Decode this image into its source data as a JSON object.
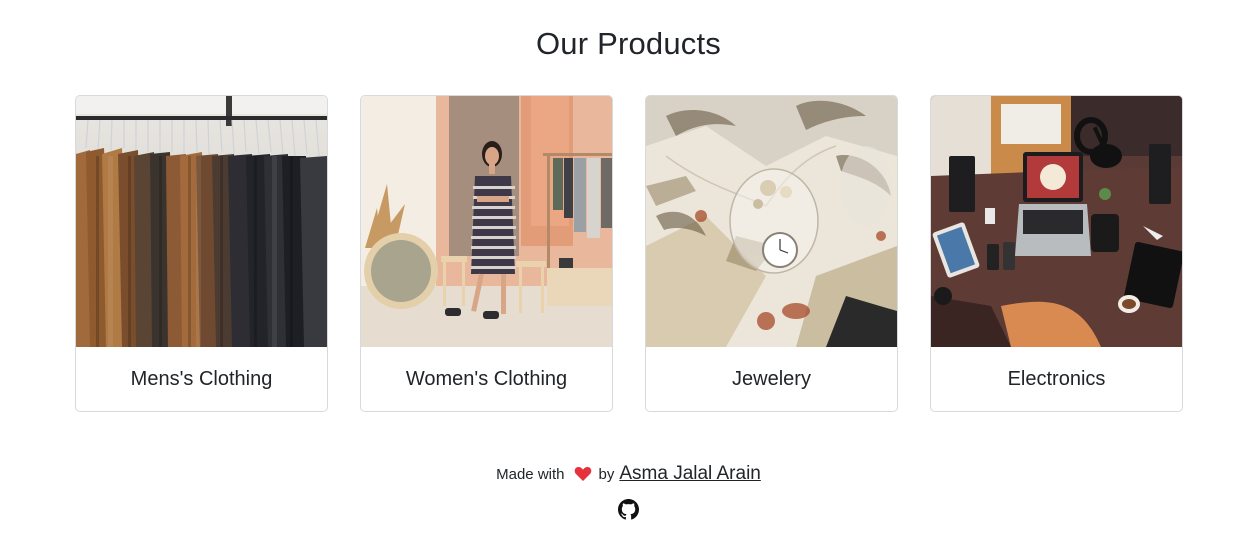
{
  "page": {
    "title": "Our Products"
  },
  "categories": [
    {
      "label": "Mens's Clothing",
      "image": "mens-clothing-image"
    },
    {
      "label": "Women's Clothing",
      "image": "womens-clothing-image"
    },
    {
      "label": "Jewelery",
      "image": "jewelery-image"
    },
    {
      "label": "Electronics",
      "image": "electronics-image"
    }
  ],
  "footer": {
    "made_with": "Made with",
    "heart_icon": "heart-icon",
    "by": "by",
    "author": "Asma Jalal Arain",
    "github_icon": "github-icon",
    "heart_color": "#e5323b"
  }
}
